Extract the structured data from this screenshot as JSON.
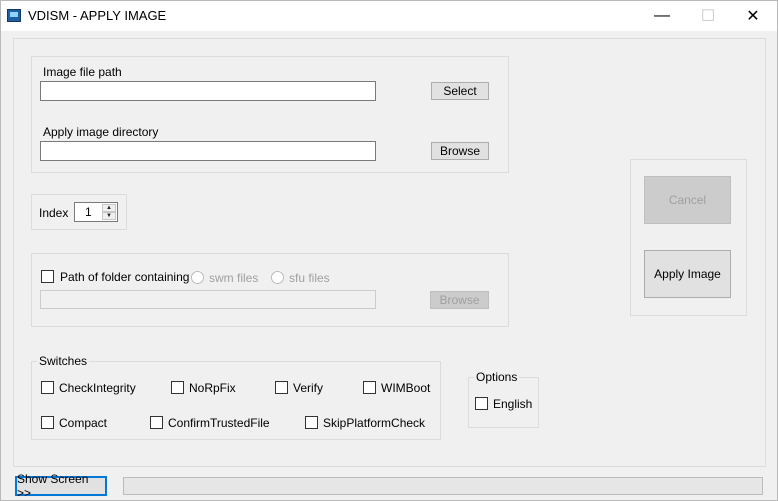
{
  "window": {
    "title": "VDISM - APPLY IMAGE",
    "minimize_glyph": "—",
    "maximize_glyph": "☐",
    "close_glyph": "✕"
  },
  "image_panel": {
    "image_path_label": "Image file path",
    "image_path_value": "",
    "select_label": "Select",
    "apply_dir_label": "Apply image directory",
    "apply_dir_value": "",
    "browse_label": "Browse"
  },
  "index": {
    "label": "Index",
    "value": "1",
    "up_glyph": "▲",
    "down_glyph": "▼"
  },
  "split_panel": {
    "path_checkbox_label": "Path of folder containing",
    "swm_label": "swm files",
    "sfu_label": "sfu files",
    "folder_value": "",
    "browse_label": "Browse"
  },
  "actions": {
    "cancel_label": "Cancel",
    "apply_label": "Apply Image"
  },
  "switches": {
    "title": "Switches",
    "items": [
      {
        "label": "CheckIntegrity",
        "checked": false
      },
      {
        "label": "NoRpFix",
        "checked": false
      },
      {
        "label": "Verify",
        "checked": false
      },
      {
        "label": "WIMBoot",
        "checked": false
      },
      {
        "label": "Compact",
        "checked": false
      },
      {
        "label": "ConfirmTrustedFile",
        "checked": false
      },
      {
        "label": "SkipPlatformCheck",
        "checked": false
      }
    ]
  },
  "options": {
    "title": "Options",
    "english_label": "English",
    "english_checked": false
  },
  "footer": {
    "show_screen_label": "Show Screen >>",
    "progress": 0
  },
  "colors": {
    "focus_border": "#0078d7",
    "disabled_text": "#a0a0a0",
    "window_bg": "#f0f0f0"
  }
}
